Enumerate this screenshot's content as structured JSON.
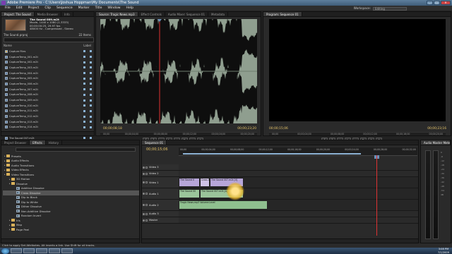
{
  "window": {
    "title": "Adobe Premiere Pro - C:\\Users\\Joshua Hoppman\\My Documents\\The Sound"
  },
  "menu": [
    "File",
    "Edit",
    "Project",
    "Clip",
    "Sequence",
    "Marker",
    "Title",
    "Window",
    "Help"
  ],
  "workspace": {
    "label": "Workspace:",
    "value": "Editing"
  },
  "project": {
    "tabs": [
      "Project: The Sound",
      "Media Browser",
      "Info"
    ],
    "clip_name": "The Sound 009.m2t",
    "clip_info": [
      "Movie, 1440 x 1080 (1.3333)",
      "00:00:00:25, 29.97 fps",
      "48000 Hz - Compressed - Stereo"
    ],
    "project_name": "The Sound.prproj",
    "items_count": "22 Items",
    "col_name": "Name",
    "col_label": "Label",
    "items": [
      "Capture Files",
      "CaptureTemp_001.m2t",
      "CaptureTemp_002.m2t",
      "CaptureTemp_003.m2t",
      "CaptureTemp_004.m2t",
      "CaptureTemp_005.m2t",
      "CaptureTemp_006.m2t",
      "CaptureTemp_007.m2t",
      "CaptureTemp_008.m2t",
      "CaptureTemp_009.m2t",
      "CaptureTemp_010.m2t",
      "CaptureTemp_011.m2t",
      "CaptureTemp_012.m2t",
      "CaptureTemp_013.m2t",
      "CaptureTemp_014.m2t",
      "The Sound 006.m2t",
      "The Sound 007.m2t",
      "The Sound 009.m2t"
    ]
  },
  "source": {
    "tabs": [
      "Source: Tragic News.mp3",
      "Effect Controls",
      "Audio Mixer: Sequence 01",
      "Metadata"
    ],
    "time_in": "00;00;08;18",
    "time_dur": "00;00;23;20",
    "ruler": [
      "00;00",
      "00;00;04;00",
      "00;00;08;00",
      "00;00;12;00",
      "00;00;16;00",
      "00;00;20;00"
    ]
  },
  "program": {
    "tabs": [
      "Program: Sequence 01"
    ],
    "time_in": "00;00;15;06",
    "time_dur": "00;00;23;16",
    "ruler": [
      "00;00",
      "00;00;04;00",
      "00;00;08;00",
      "00;00;12;00",
      "00;00;16;00",
      "00;00;20;00"
    ]
  },
  "effects": {
    "tabs": [
      "Project Browser",
      "Effects",
      "History"
    ],
    "items": [
      {
        "label": "Presets",
        "kind": "folder",
        "depth": 0
      },
      {
        "label": "Audio Effects",
        "kind": "folder",
        "depth": 0
      },
      {
        "label": "Audio Transitions",
        "kind": "folder",
        "depth": 0
      },
      {
        "label": "Video Effects",
        "kind": "folder",
        "depth": 0
      },
      {
        "label": "Video Transitions",
        "kind": "folder",
        "depth": 0
      },
      {
        "label": "3D Motion",
        "kind": "folder",
        "depth": 1
      },
      {
        "label": "Dissolve",
        "kind": "folder",
        "depth": 1
      },
      {
        "label": "Additive Dissolve",
        "kind": "transition",
        "depth": 2
      },
      {
        "label": "Cross Dissolve",
        "kind": "transition",
        "depth": 2,
        "selected": true
      },
      {
        "label": "Dip to Black",
        "kind": "transition",
        "depth": 2
      },
      {
        "label": "Dip to White",
        "kind": "transition",
        "depth": 2
      },
      {
        "label": "Dither Dissolve",
        "kind": "transition",
        "depth": 2
      },
      {
        "label": "Non-Additive Dissolve",
        "kind": "transition",
        "depth": 2
      },
      {
        "label": "Random Invert",
        "kind": "transition",
        "depth": 2
      },
      {
        "label": "Iris",
        "kind": "folder",
        "depth": 1
      },
      {
        "label": "Map",
        "kind": "folder",
        "depth": 1
      },
      {
        "label": "Page Peel",
        "kind": "folder",
        "depth": 1
      }
    ]
  },
  "timeline": {
    "tabs": [
      "Sequence 01"
    ],
    "timecode": "00;00;15;06",
    "ruler": [
      "00;00",
      "00;00;04;00",
      "00;00;08;00",
      "00;00;12;00",
      "00;00;16;00",
      "00;00;20;00",
      "00;00;24;00",
      "00;00;28;00",
      "00;00;32;00"
    ],
    "tracks": [
      {
        "label": "Video 3",
        "kind": "video",
        "tall": false
      },
      {
        "label": "Video 2",
        "kind": "video",
        "tall": false
      },
      {
        "label": "Video 1",
        "kind": "video",
        "tall": true
      },
      {
        "label": "Audio 1",
        "kind": "audio",
        "tall": true
      },
      {
        "label": "Audio 2",
        "kind": "audio",
        "tall": true
      },
      {
        "label": "Audio 3",
        "kind": "audio",
        "tall": false
      },
      {
        "label": "Master",
        "kind": "audio",
        "tall": false
      }
    ],
    "clips": {
      "v1a": "The Sound 0",
      "v1b": "Cross Dis",
      "v1c": "The Sound 007.m2t [V]",
      "a1a": "The Sound 00",
      "a1b": "The Sound 007.m2t [A]",
      "a2": "Tragic News.mp3  Volume:Level"
    }
  },
  "audio_master": {
    "tabs": [
      "Audio Master Meters"
    ],
    "scale": [
      "0",
      "-6",
      "-12",
      "-18",
      "-24",
      "-30",
      "-36",
      "-42",
      "-48",
      "-54",
      "dB"
    ]
  },
  "status": "Click to apply Set Attributes. Alt inserts a link. Use Shift for all tracks.",
  "taskbar": {
    "time": "3:08 PM",
    "date": "7/1/2009"
  }
}
